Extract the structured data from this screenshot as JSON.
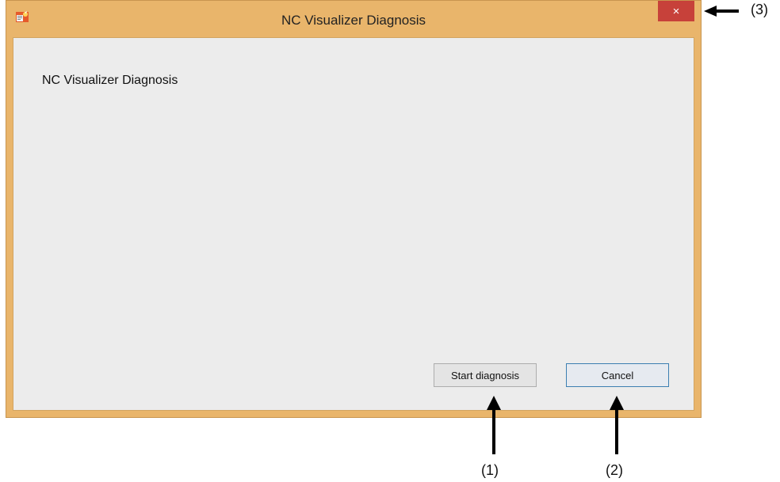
{
  "window": {
    "title": "NC Visualizer Diagnosis",
    "close_glyph": "×",
    "app_icon": "app-icon"
  },
  "client": {
    "heading": "NC Visualizer Diagnosis"
  },
  "buttons": {
    "start_label": "Start diagnosis",
    "cancel_label": "Cancel"
  },
  "callouts": {
    "one": "(1)",
    "two": "(2)",
    "three": "(3)"
  },
  "colors": {
    "frame": "#e9b56b",
    "close": "#c7413a",
    "client_bg": "#ececec",
    "cancel_border": "#3c7fb1"
  }
}
